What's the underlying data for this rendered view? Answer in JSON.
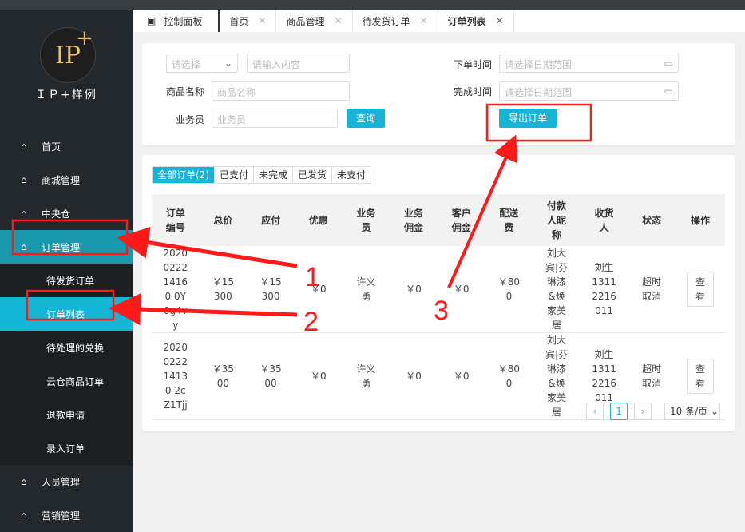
{
  "sidebar": {
    "brand": "ＩＰ+样例",
    "logo_text": "IP",
    "logo_plus": "+",
    "items": [
      {
        "label": "首页"
      },
      {
        "label": "商城管理"
      },
      {
        "label": "中央仓"
      },
      {
        "label": "订单管理",
        "active": true
      },
      {
        "label": "人员管理"
      },
      {
        "label": "营销管理"
      }
    ],
    "sub_items": [
      {
        "label": "待发货订单"
      },
      {
        "label": "订单列表",
        "active": true
      },
      {
        "label": "待处理的兑换"
      },
      {
        "label": "云仓商品订单"
      },
      {
        "label": "退款申请"
      },
      {
        "label": "录入订单"
      }
    ]
  },
  "tabs": [
    {
      "label": "控制面板"
    },
    {
      "label": "首页"
    },
    {
      "label": "商品管理"
    },
    {
      "label": "待发货订单"
    },
    {
      "label": "订单列表",
      "current": true
    }
  ],
  "filters": {
    "select_placeholder": "请选择",
    "keyword_placeholder": "请输入内容",
    "product_label": "商品名称",
    "product_placeholder": "商品名称",
    "staff_label": "业务员",
    "staff_placeholder": "业务员",
    "query_button": "查询",
    "order_time_label": "下单时间",
    "order_time_placeholder": "请选择日期范围",
    "finish_time_label": "完成时间",
    "finish_time_placeholder": "请选择日期范围",
    "export_button": "导出订单"
  },
  "status_tabs": [
    "全部订单(2)",
    "已支付",
    "未完成",
    "已发货",
    "未支付"
  ],
  "table": {
    "headers": [
      "订单编号",
      "总价",
      "应付",
      "优惠",
      "业务员",
      "业务佣金",
      "客户佣金",
      "配送费",
      "付款人昵称",
      "收货人",
      "状态",
      "操作"
    ],
    "rows": [
      [
        "2020022214160 0Y6g4vy",
        "￥15300",
        "￥15300",
        "￥0",
        "许义勇",
        "￥0",
        "￥0",
        "￥800",
        "刘大宾|芬琳漆&焕家美居",
        "刘生13112216011",
        "超时取消",
        "查看"
      ],
      [
        "2020022214130 2cZ1Tjj",
        "￥3500",
        "￥3500",
        "￥0",
        "许义勇",
        "￥0",
        "￥0",
        "￥800",
        "刘大宾|芬琳漆&焕家美居",
        "刘生13112216011",
        "超时取消",
        "查看"
      ]
    ]
  },
  "pagination": {
    "prev": "‹",
    "current": "1",
    "next": "›",
    "page_size": "10 条/页"
  },
  "annotations": [
    "1",
    "2",
    "3"
  ],
  "colors": {
    "accent": "#17b4d8",
    "sidebar": "#23282c",
    "annotation": "#ff1a1a"
  }
}
